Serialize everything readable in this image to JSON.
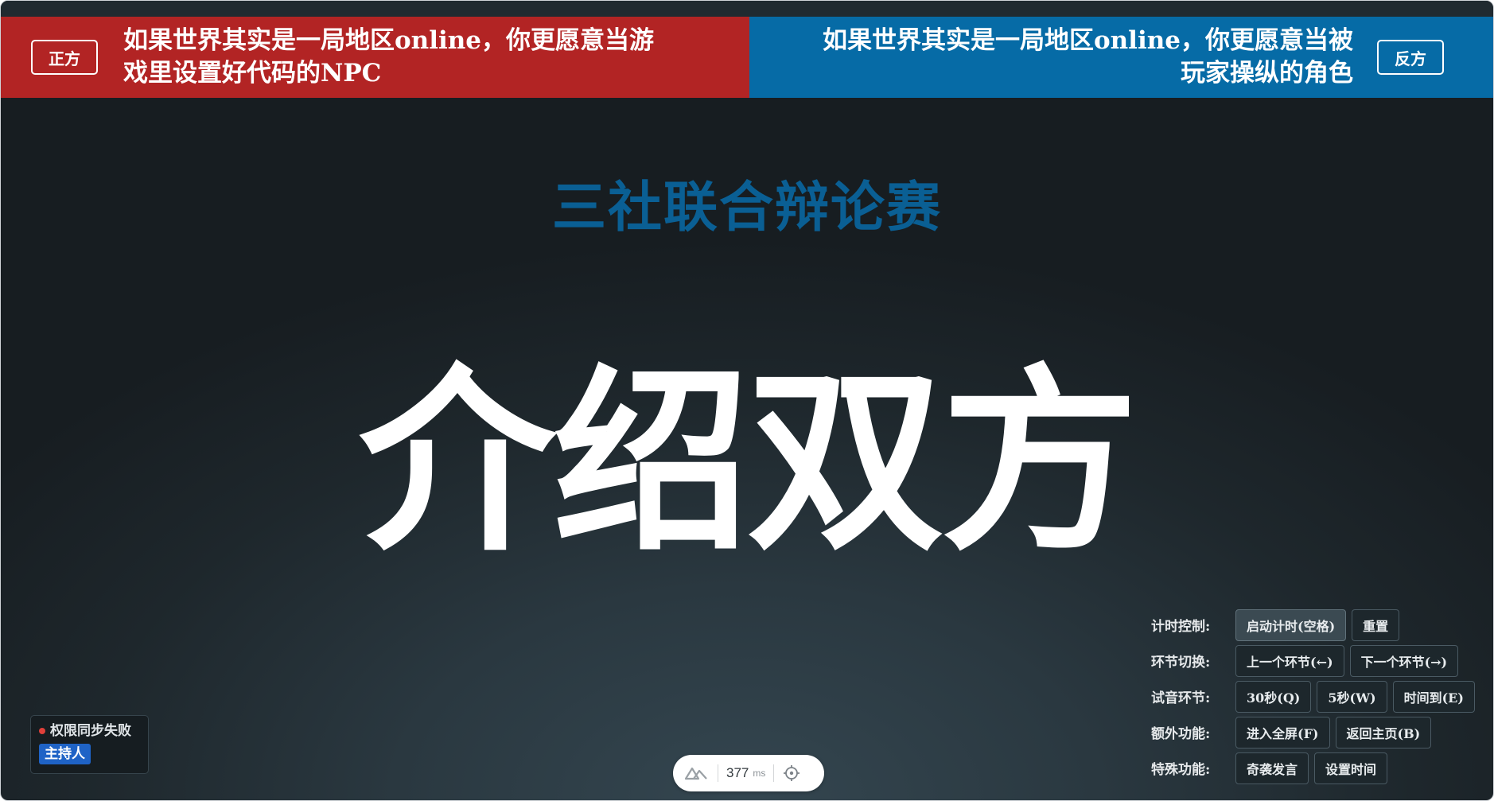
{
  "pro_side": {
    "badge": "正方",
    "topic": "如果世界其实是一局地区online，你更愿意当游戏里设置好代码的NPC",
    "color": "#b22424"
  },
  "con_side": {
    "badge": "反方",
    "topic": "如果世界其实是一局地区online，你更愿意当被玩家操纵的角色",
    "color": "#066ba6"
  },
  "event_title": "三社联合辩论赛",
  "stage_title": "介绍双方",
  "controls": {
    "timer": {
      "label": "计时控制:",
      "start": "启动计时(空格)",
      "reset": "重置"
    },
    "segment": {
      "label": "环节切换:",
      "prev": "上一个环节(←)",
      "next": "下一个环节(→)"
    },
    "sound_test": {
      "label": "试音环节:",
      "thirty": "30秒(Q)",
      "five": "5秒(W)",
      "time_up": "时间到(E)"
    },
    "extra": {
      "label": "额外功能:",
      "fullscreen": "进入全屏(F)",
      "home": "返回主页(B)"
    },
    "special": {
      "label": "特殊功能:",
      "odd_speech": "奇袭发言",
      "set_time": "设置时间"
    }
  },
  "host_panel": {
    "sync_status": "权限同步失败",
    "role": "主持人",
    "status_color": "#e0403a"
  },
  "dev_pill": {
    "logo_icon": "nuxt-logo-icon",
    "latency_value": "377",
    "latency_unit": "ms",
    "inspect_icon": "target-icon"
  }
}
